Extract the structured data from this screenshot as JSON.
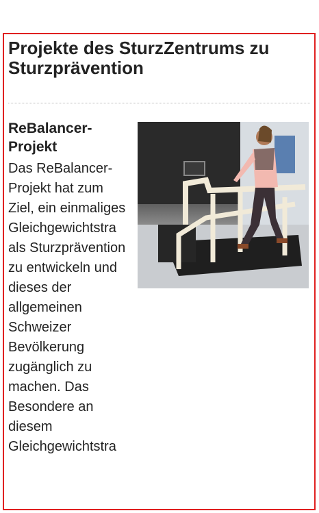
{
  "page": {
    "title": "Projekte des SturzZentrums zu Sturzprävention"
  },
  "article": {
    "heading": "ReBalancer-Projekt",
    "body": "Das ReBalancer-Projekt hat zum Ziel, ein einmaliges Gleichgewichtstra als Sturzprävention zu entwickeln und dieses  der allgemeinen Schweizer Bevölkerung zugänglich zu machen. Das Besondere an diesem Gleichgewichtstra",
    "image": {
      "icon": "treadmill-photo"
    }
  },
  "colors": {
    "frame_border": "#e02020",
    "text": "#222222",
    "divider": "#bbbbbb"
  }
}
